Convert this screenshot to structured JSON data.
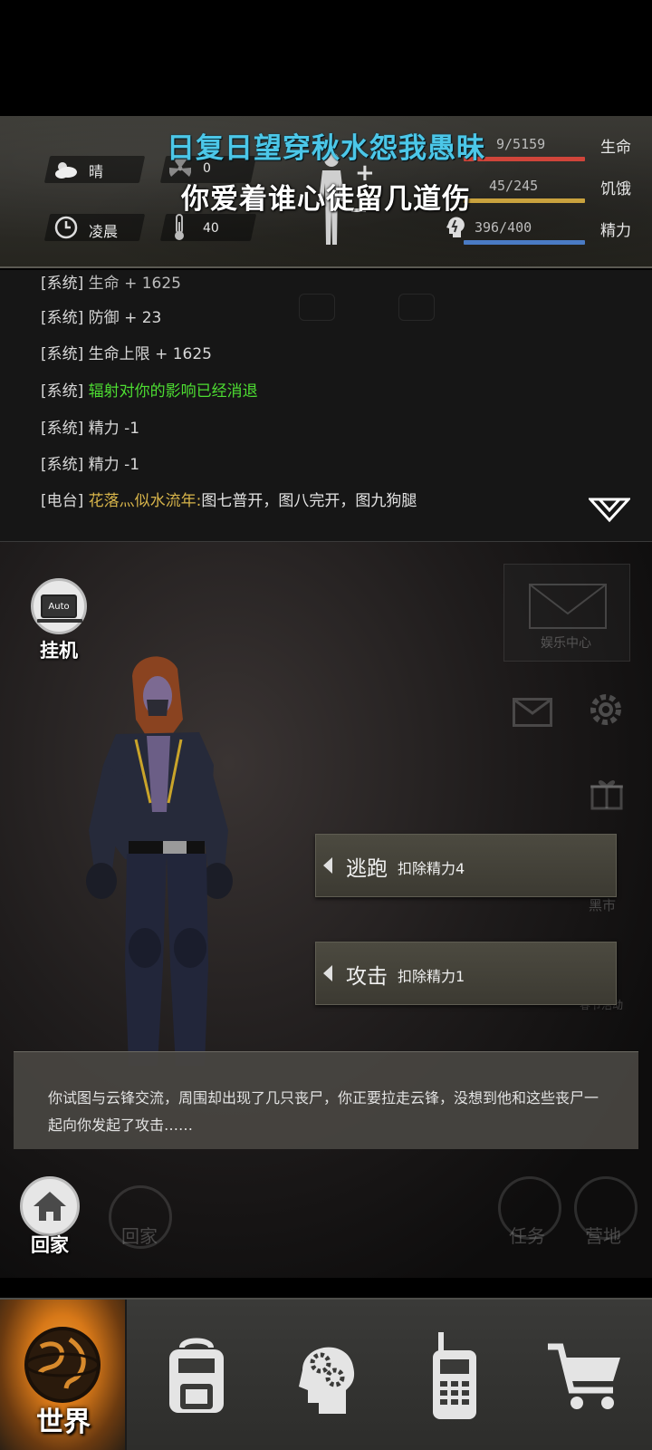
{
  "status": {
    "weather": "晴",
    "radiation": "0",
    "time_of_day": "凌晨",
    "temperature": "40",
    "health": {
      "text": "9/5159",
      "label": "生命",
      "color": "#d0453a"
    },
    "hunger": {
      "text": "45/245",
      "label": "饥饿",
      "color": "#c9a23e"
    },
    "energy": {
      "text": "396/400",
      "label": "精力",
      "color": "#4a7bc4"
    }
  },
  "lyrics": {
    "line1": "日复日望穿秋水怨我愚昧",
    "line2": "你爱着谁心徒留几道伤"
  },
  "log": [
    {
      "tag": "[系统]",
      "msg": "生命 + 1625"
    },
    {
      "tag": "[系统]",
      "msg": "防御 + 23"
    },
    {
      "tag": "[系统]",
      "msg": "生命上限 + 1625"
    },
    {
      "tag": "[系统]",
      "msg": "辐射对你的影响已经消退"
    },
    {
      "tag": "[系统]",
      "msg": "精力 -1"
    },
    {
      "tag": "[系统]",
      "msg": "精力 -1"
    },
    {
      "tag": "[电台]",
      "msg": "花落灬似水流年:",
      "msg2": "图七普开，图八完开，图九狗腿"
    }
  ],
  "scene": {
    "auto_icon_text": "Auto",
    "auto_label": "挂机",
    "entertainment_label": "娱乐中心",
    "market_label": "黑市",
    "event_label": "春节活动",
    "home_label": "回家",
    "home_faint_label": "回家",
    "task_label": "任务",
    "camp_label": "营地"
  },
  "actions": [
    {
      "name": "逃跑",
      "cost": "扣除精力4"
    },
    {
      "name": "攻击",
      "cost": "扣除精力1"
    }
  ],
  "dialog": {
    "text": "你试图与云锋交流，周围却出现了几只丧尸，你正要拉走云锋，没想到他和这些丧尸一起向你发起了攻击……"
  },
  "nav": {
    "world_label": "世界",
    "tabs": [
      "world-globe-icon",
      "backpack-icon",
      "skills-head-icon",
      "radio-icon",
      "shop-cart-icon"
    ]
  }
}
